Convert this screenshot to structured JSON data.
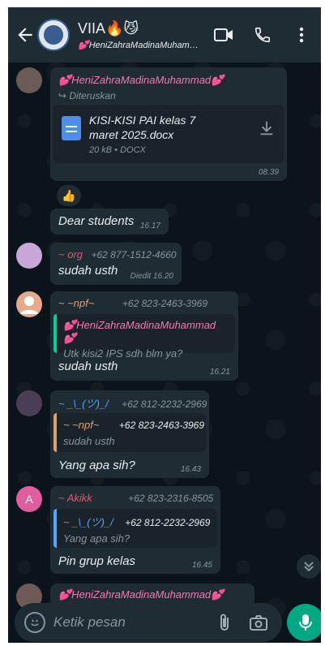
{
  "header": {
    "title": "VIIA🔥😼",
    "subtitle": "💕HeniZahraMadinaMuhamma…"
  },
  "messages": [
    {
      "sender": "💕HeniZahraMadinaMuhammad💕",
      "forwarded": "Diteruskan",
      "document": {
        "name": "KISI-KISI PAI kelas 7 maret 2025.docx",
        "meta": "20 kB • DOCX"
      },
      "time": "08.39",
      "reaction": "👍"
    },
    {
      "text": "Dear students",
      "time": "16.17"
    },
    {
      "sender": "~ org",
      "phone": "+62 877-1512-4660",
      "text": "sudah usth",
      "time": "Diedit 16.20"
    },
    {
      "sender": "~ ~npf~",
      "phone": "+62 823-2463-3969",
      "quote": {
        "sender": "💕HeniZahraMadinaMuhammad💕",
        "text": "Utk kisi2 IPS sdh blm ya?"
      },
      "text": "sudah usth",
      "time": "16.21"
    },
    {
      "sender": "~ _\\_(ツ)_/",
      "phone": "+62 812-2232-2969",
      "quote": {
        "sender": "~ ~npf~",
        "phone": "+62 823-2463-3969",
        "text": "sudah usth"
      },
      "text": "Yang apa sih?",
      "time": "16.43"
    },
    {
      "sender": "~ Akikk",
      "phone": "+62 823-2316-8505",
      "avatar_letter": "A",
      "quote": {
        "sender": "~ _\\_(ツ)_/",
        "phone": "+62 812-2232-2969",
        "text": "Yang apa sih?"
      },
      "text": "Pin grup kelas",
      "time": "16.45"
    },
    {
      "sender": "💕HeniZahraMadinaMuhammad💕"
    }
  ],
  "input": {
    "placeholder": "Ketik pesan"
  },
  "colors": {
    "accent": "#00a884",
    "pink": "#f07cb4",
    "orange_quote": "#e0a06b",
    "blue_quote": "#53a6fd",
    "green_quote": "#06cf9c"
  }
}
